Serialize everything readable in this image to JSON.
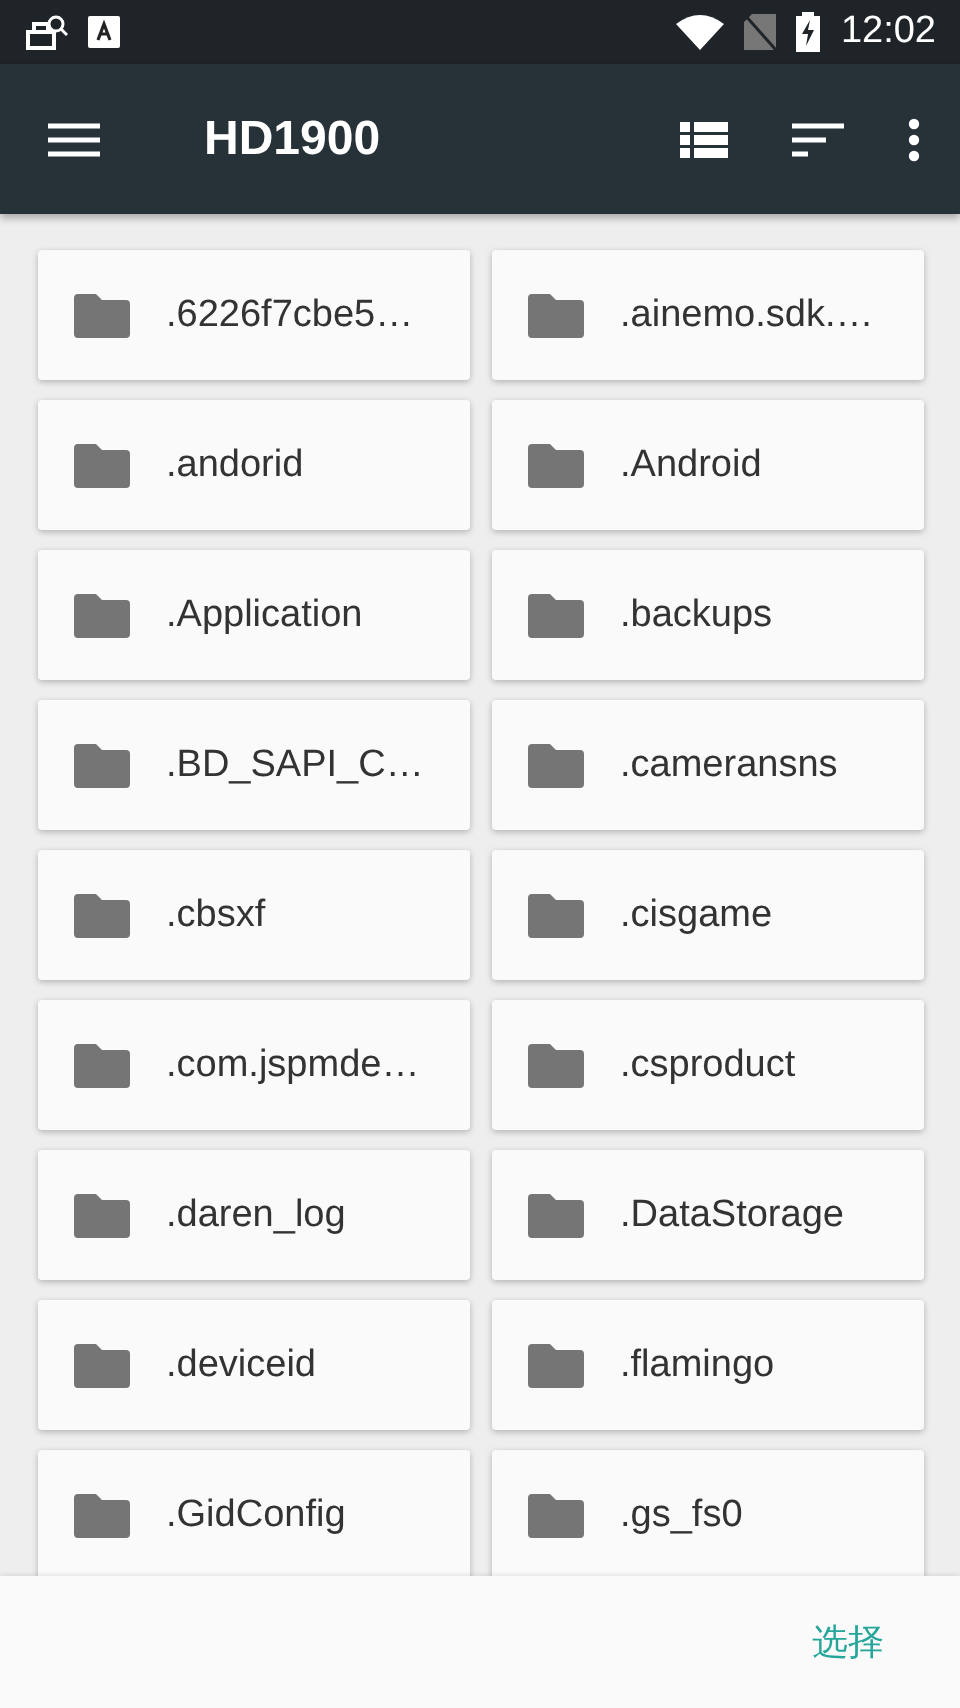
{
  "status_bar": {
    "time": "12:02"
  },
  "app_bar": {
    "title": "HD1900"
  },
  "folders": [
    {
      "name": ".6226f7cbe5…"
    },
    {
      "name": ".ainemo.sdk.…"
    },
    {
      "name": ".andorid"
    },
    {
      "name": ".Android"
    },
    {
      "name": ".Application"
    },
    {
      "name": ".backups"
    },
    {
      "name": ".BD_SAPI_C…"
    },
    {
      "name": ".cameransns"
    },
    {
      "name": ".cbsxf"
    },
    {
      "name": ".cisgame"
    },
    {
      "name": ".com.jspmde…"
    },
    {
      "name": ".csproduct"
    },
    {
      "name": ".daren_log"
    },
    {
      "name": ".DataStorage"
    },
    {
      "name": ".deviceid"
    },
    {
      "name": ".flamingo"
    },
    {
      "name": ".GidConfig"
    },
    {
      "name": ".gs_fs0"
    }
  ],
  "bottom_bar": {
    "action": "选择"
  }
}
